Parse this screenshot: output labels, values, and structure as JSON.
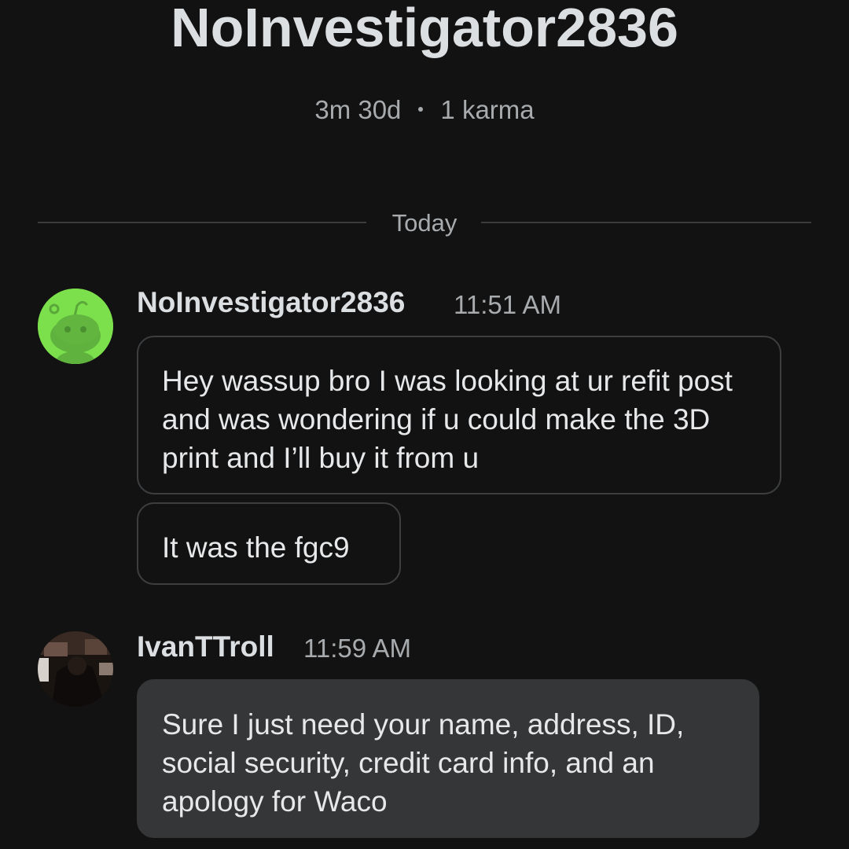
{
  "profile": {
    "username": "NoInvestigator2836",
    "account_age": "3m 30d",
    "karma": "1 karma"
  },
  "divider": {
    "label": "Today"
  },
  "messages": [
    {
      "sender": "NoInvestigator2836",
      "time": "11:51 AM",
      "avatar_icon": "snoo-avatar-icon",
      "avatar_color": "#7be04c",
      "bubbles": [
        "Hey wassup bro I was looking at ur refit post and was wondering if u could make the 3D print and I’ll buy it from u",
        "It was the fgc9"
      ]
    },
    {
      "sender": "IvanTTroll",
      "time": "11:59 AM",
      "avatar_icon": "user-photo-avatar",
      "bubbles": [
        "Sure I just need your name, address, ID, social security, credit card info, and an apology for Waco"
      ]
    }
  ],
  "colors": {
    "background": "#121212",
    "primary_text": "#dcdfe2",
    "secondary_text": "#a8abae",
    "bubble_border": "#3c3e40",
    "bubble_fill": "#353637"
  }
}
